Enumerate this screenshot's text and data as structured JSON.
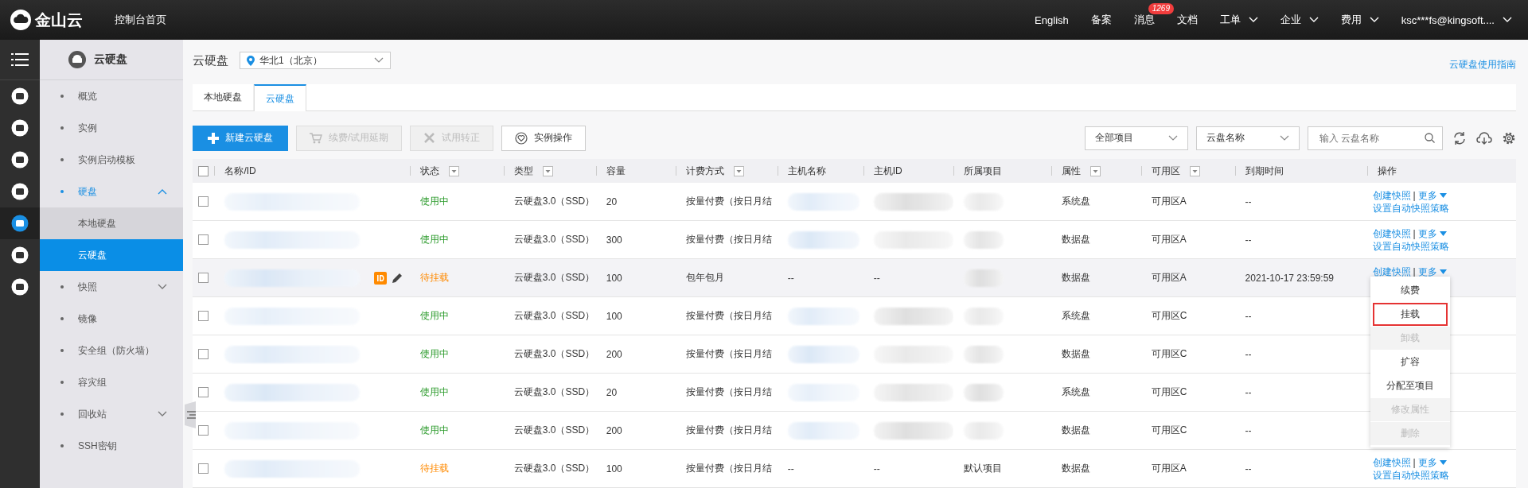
{
  "topbar": {
    "logo": "金山云",
    "home": "控制台首页",
    "nav": [
      {
        "label": "English",
        "dropdown": false
      },
      {
        "label": "备案",
        "dropdown": false
      },
      {
        "label": "消息",
        "dropdown": false,
        "badge": "1269"
      },
      {
        "label": "文档",
        "dropdown": false
      },
      {
        "label": "工单",
        "dropdown": true
      },
      {
        "label": "企业",
        "dropdown": true
      },
      {
        "label": "费用",
        "dropdown": true
      },
      {
        "label": "ksc***fs@kingsoft....",
        "dropdown": true
      }
    ]
  },
  "rail": [
    {
      "selected": false
    },
    {
      "selected": false
    },
    {
      "selected": false
    },
    {
      "selected": false
    },
    {
      "selected": true
    },
    {
      "selected": false
    },
    {
      "selected": false
    }
  ],
  "sidebar": {
    "title": "云硬盘",
    "items": [
      {
        "label": "概览",
        "selected": false
      },
      {
        "label": "实例",
        "selected": false
      },
      {
        "label": "实例启动模板",
        "selected": false
      },
      {
        "label": "硬盘",
        "selected": false,
        "expanded": true,
        "children": [
          {
            "label": "本地硬盘",
            "selected": false
          },
          {
            "label": "云硬盘",
            "selected": true
          }
        ]
      },
      {
        "label": "快照",
        "selected": false,
        "expanded": false
      },
      {
        "label": "镜像",
        "selected": false
      },
      {
        "label": "安全组（防火墙）",
        "selected": false
      },
      {
        "label": "容灾组",
        "selected": false
      },
      {
        "label": "回收站",
        "selected": false,
        "expanded": false
      },
      {
        "label": "SSH密钥",
        "selected": false
      }
    ]
  },
  "header": {
    "title": "云硬盘",
    "region": "华北1（北京）",
    "guide_link": "云硬盘使用指南"
  },
  "tabs": [
    {
      "label": "本地硬盘",
      "selected": false
    },
    {
      "label": "云硬盘",
      "selected": true
    }
  ],
  "toolbar": {
    "buttons": [
      {
        "label": "新建云硬盘",
        "kind": "primary",
        "disabled": false
      },
      {
        "label": "续费/试用延期",
        "kind": "cart",
        "disabled": true
      },
      {
        "label": "试用转正",
        "kind": "tools",
        "disabled": true
      },
      {
        "label": "实例操作",
        "kind": "heart",
        "disabled": false
      }
    ],
    "project_select": "全部项目",
    "field_select": "云盘名称",
    "search": {
      "placeholder": "输入 云盘名称"
    }
  },
  "table": {
    "all_checked": false,
    "columns": [
      {
        "label": "名称/ID",
        "filter": false
      },
      {
        "label": "状态",
        "filter": true
      },
      {
        "label": "类型",
        "filter": true
      },
      {
        "label": "容量",
        "filter": false
      },
      {
        "label": "计费方式",
        "filter": true
      },
      {
        "label": "主机名称",
        "filter": false
      },
      {
        "label": "主机ID",
        "filter": false
      },
      {
        "label": "所属项目",
        "filter": false
      },
      {
        "label": "属性",
        "filter": true
      },
      {
        "label": "可用区",
        "filter": true
      },
      {
        "label": "到期时间",
        "filter": false
      },
      {
        "label": "操作",
        "filter": false
      }
    ],
    "rows": [
      {
        "checked": false,
        "hover": false,
        "status": {
          "text": "使用中",
          "kind": "ok"
        },
        "type": "云硬盘3.0（SSD）",
        "capacity": "20",
        "billing": "按量付费（按日月结",
        "attribute": "系统盘",
        "zone": "可用区A",
        "expiry": "--",
        "actions": {
          "snapshot": "创建快照",
          "sep": "|",
          "more": "更多",
          "policy": "设置自动快照策略"
        }
      },
      {
        "checked": false,
        "hover": false,
        "status": {
          "text": "使用中",
          "kind": "ok"
        },
        "type": "云硬盘3.0（SSD）",
        "capacity": "300",
        "billing": "按量付费（按日月结",
        "attribute": "数据盘",
        "zone": "可用区A",
        "expiry": "--",
        "actions": {
          "snapshot": "创建快照",
          "sep": "|",
          "more": "更多",
          "policy": "设置自动快照策略"
        }
      },
      {
        "checked": false,
        "hover": true,
        "status": {
          "text": "待挂载",
          "kind": "pending"
        },
        "type": "云硬盘3.0（SSD）",
        "capacity": "100",
        "billing": "包年包月",
        "host_name": "--",
        "host_id": "--",
        "attribute": "数据盘",
        "zone": "可用区A",
        "expiry": "2021-10-17 23:59:59",
        "actions": {
          "snapshot": "创建快照",
          "sep": "|",
          "more": "更多"
        }
      },
      {
        "checked": false,
        "hover": false,
        "status": {
          "text": "使用中",
          "kind": "ok"
        },
        "type": "云硬盘3.0（SSD）",
        "capacity": "100",
        "billing": "按量付费（按日月结",
        "attribute": "系统盘",
        "zone": "可用区C",
        "expiry": "--"
      },
      {
        "checked": false,
        "hover": false,
        "status": {
          "text": "使用中",
          "kind": "ok"
        },
        "type": "云硬盘3.0（SSD）",
        "capacity": "200",
        "billing": "按量付费（按日月结",
        "attribute": "数据盘",
        "zone": "可用区C",
        "expiry": "--"
      },
      {
        "checked": false,
        "hover": false,
        "status": {
          "text": "使用中",
          "kind": "ok"
        },
        "type": "云硬盘3.0（SSD）",
        "capacity": "20",
        "billing": "按量付费（按日月结",
        "attribute": "系统盘",
        "zone": "可用区C",
        "expiry": "--"
      },
      {
        "checked": false,
        "hover": false,
        "status": {
          "text": "使用中",
          "kind": "ok"
        },
        "type": "云硬盘3.0（SSD）",
        "capacity": "200",
        "billing": "按量付费（按日月结",
        "attribute": "数据盘",
        "zone": "可用区C",
        "expiry": "--"
      },
      {
        "checked": false,
        "hover": false,
        "status": {
          "text": "待挂载",
          "kind": "pending"
        },
        "type": "云硬盘3.0（SSD）",
        "capacity": "100",
        "billing": "按量付费（按日月结",
        "host_name": "--",
        "host_id": "--",
        "project": "默认项目",
        "attribute": "数据盘",
        "zone": "可用区A",
        "expiry": "--",
        "actions": {
          "snapshot": "创建快照",
          "sep": "|",
          "more": "更多",
          "policy": "设置自动快照策略"
        }
      }
    ]
  },
  "more_menu": {
    "items": [
      {
        "label": "续费",
        "disabled": false,
        "highlighted": false
      },
      {
        "label": "挂载",
        "disabled": false,
        "highlighted": true
      },
      {
        "label": "卸载",
        "disabled": true,
        "highlighted": false
      },
      {
        "label": "扩容",
        "disabled": false,
        "highlighted": false
      },
      {
        "label": "分配至项目",
        "disabled": false,
        "highlighted": false
      },
      {
        "label": "修改属性",
        "disabled": true,
        "highlighted": false
      },
      {
        "label": "删除",
        "disabled": true,
        "highlighted": false
      }
    ]
  }
}
